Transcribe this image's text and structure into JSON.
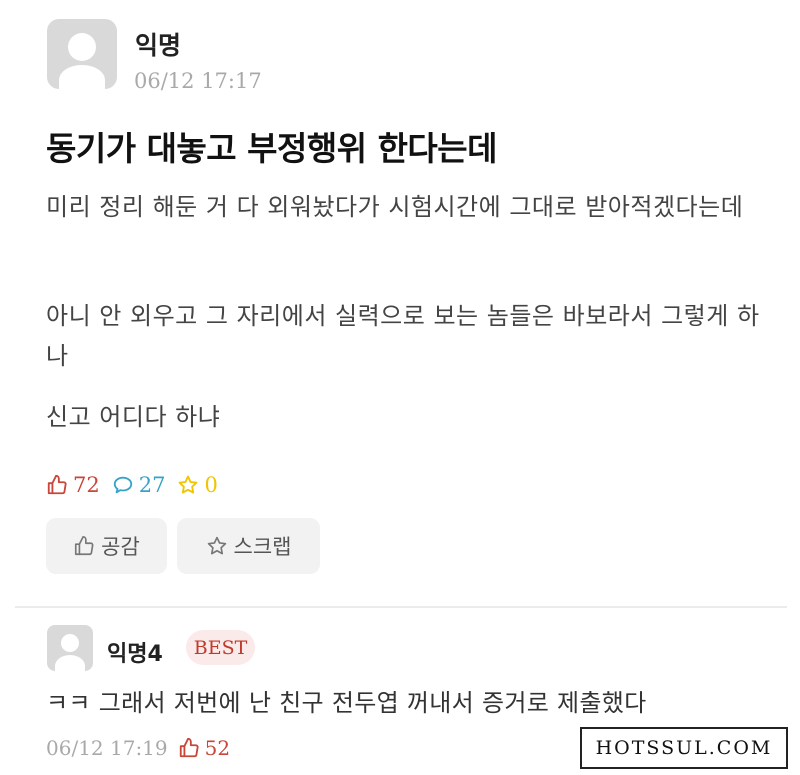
{
  "post": {
    "author": "익명",
    "date": "06/12 17:17",
    "title": "동기가 대놓고 부정행위 한다는데",
    "paragraphs": [
      "미리 정리 해둔 거 다 외워놨다가 시험시간에 그대로 받아적겠다는데",
      "아니 안 외우고 그 자리에서 실력으로 보는 놈들은 바보라서 그렇게 하나",
      "신고 어디다 하냐"
    ],
    "stats": {
      "likes": "72",
      "comments": "27",
      "scraps": "0"
    },
    "actions": {
      "like_label": "공감",
      "scrap_label": "스크랩"
    }
  },
  "comment": {
    "author": "익명4",
    "badge": "BEST",
    "text": "ㅋㅋ 그래서 저번에 난 친구 전두엽 꺼내서 증거로 제출했다",
    "date": "06/12 17:19",
    "likes": "52"
  },
  "watermark": "HOTSSUL.COM",
  "colors": {
    "like": "#c8463a",
    "comment": "#37a3c8",
    "scrap": "#f1c400",
    "best_bg": "#fbeaea"
  },
  "icons": {
    "like": "thumbs-up-icon",
    "comment": "speech-bubble-icon",
    "scrap": "star-icon",
    "avatar": "default-avatar-icon"
  }
}
